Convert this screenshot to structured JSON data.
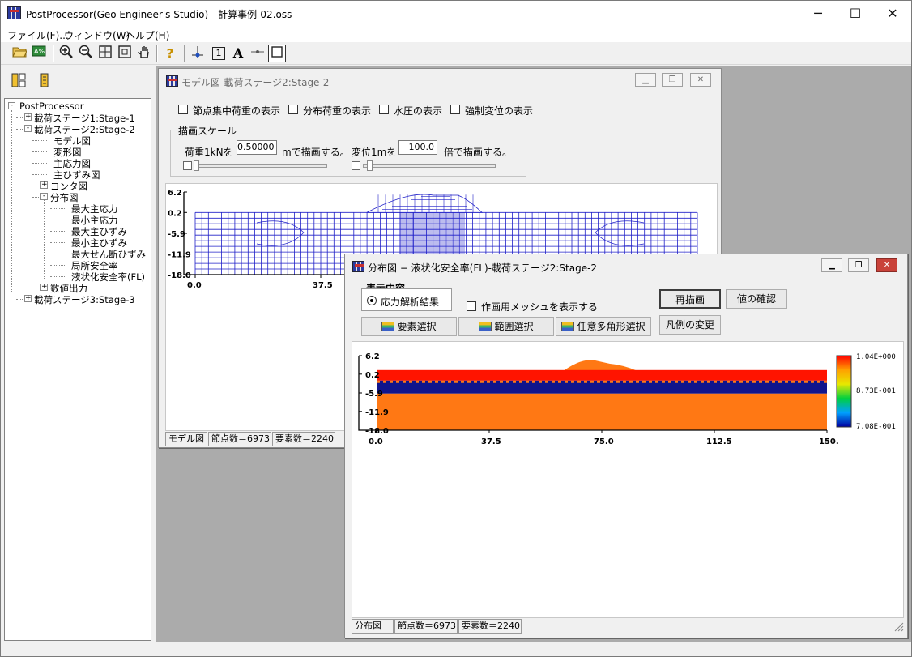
{
  "app": {
    "title": "PostProcessor(Geo Engineer's Studio) - 計算事例-02.oss",
    "controls": {
      "minimize": "─",
      "maximize": "☐",
      "close": "✕"
    }
  },
  "menu": [
    "ファイル(F)...",
    "ウィンドウ(W)",
    "ヘルプ(H)"
  ],
  "toolbar": {
    "icons": [
      "open-folder-icon",
      "export-icon",
      "zoom-in-icon",
      "zoom-out-icon",
      "fit-all-icon",
      "zoom-window-icon",
      "pan-hand-icon",
      "help-icon",
      "node-icon",
      "number-icon",
      "text-icon",
      "line-icon",
      "frame-icon"
    ],
    "text_label": "A",
    "number_label": "1",
    "help_label": "?"
  },
  "tree": {
    "root": "PostProcessor",
    "items": [
      {
        "label": "載荷ステージ1:Stage-1",
        "level": 1,
        "expand": "+"
      },
      {
        "label": "載荷ステージ2:Stage-2",
        "level": 1,
        "expand": "-"
      },
      {
        "label": "モデル図",
        "level": 2
      },
      {
        "label": "変形図",
        "level": 2
      },
      {
        "label": "主応力図",
        "level": 2
      },
      {
        "label": "主ひずみ図",
        "level": 2
      },
      {
        "label": "コンタ図",
        "level": 2,
        "expand": "+"
      },
      {
        "label": "分布図",
        "level": 2,
        "expand": "-"
      },
      {
        "label": "最大主応力",
        "level": 3
      },
      {
        "label": "最小主応力",
        "level": 3
      },
      {
        "label": "最大主ひずみ",
        "level": 3
      },
      {
        "label": "最小主ひずみ",
        "level": 3
      },
      {
        "label": "最大せん断ひずみ",
        "level": 3
      },
      {
        "label": "局所安全率",
        "level": 3
      },
      {
        "label": "液状化安全率(FL)",
        "level": 3
      },
      {
        "label": "数値出力",
        "level": 2,
        "expand": "+"
      },
      {
        "label": "載荷ステージ3:Stage-3",
        "level": 1,
        "expand": "+"
      }
    ]
  },
  "model_window": {
    "title": "モデル図-載荷ステージ2:Stage-2",
    "checkboxes": [
      "節点集中荷重の表示",
      "分布荷重の表示",
      "水圧の表示",
      "強制変位の表示"
    ],
    "scale_group": "描画スケール",
    "load_prefix": "荷重1kNを",
    "load_value": "0.50000",
    "load_suffix": "mで描画する。",
    "disp_prefix": "変位1mを",
    "disp_value": "100.0",
    "disp_suffix": "倍で描画する。",
    "y_ticks": [
      "6.2",
      "0.2",
      "-5.9",
      "-11.9",
      "-18.0"
    ],
    "x_ticks": [
      "0.0",
      "37.5"
    ],
    "status": [
      "モデル図",
      "節点数＝6973",
      "要素数＝2240"
    ]
  },
  "dist_window": {
    "title": "分布図 − 液状化安全率(FL)-載荷ステージ2:Stage-2",
    "display_group": "表示内容",
    "radio_label": "応力解析結果",
    "mesh_checkbox": "作画用メッシュを表示する",
    "buttons": {
      "redraw": "再描画",
      "check": "値の確認",
      "select_element": "要素選択",
      "select_range": "範囲選択",
      "select_polygon": "任意多角形選択",
      "legend": "凡例の変更"
    },
    "y_ticks": [
      "6.2",
      "0.2",
      "-5.9",
      "-11.9",
      "-18.0"
    ],
    "x_ticks": [
      "0.0",
      "37.5",
      "75.0",
      "112.5",
      "150."
    ],
    "legend": [
      "1.04E+000",
      "8.73E-001",
      "7.08E-001"
    ],
    "status": [
      "分布図",
      "節点数＝6973",
      "要素数＝2240"
    ],
    "colors": {
      "red": "#ff1400",
      "navy": "#10148c",
      "orange": "#ff7814"
    }
  }
}
